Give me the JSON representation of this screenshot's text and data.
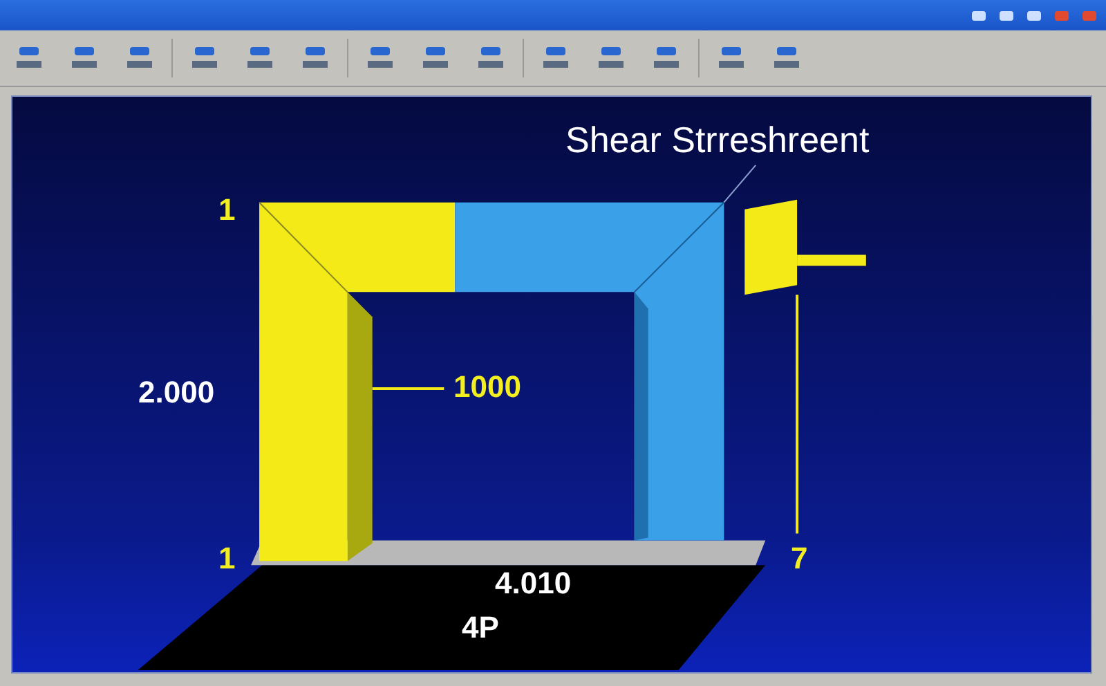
{
  "viewport": {
    "title": "Shear Strreshreent",
    "labels": [
      {
        "text": "1",
        "kind": "dimension"
      },
      {
        "text": "2.000",
        "kind": "value"
      },
      {
        "text": "1000",
        "kind": "dimension"
      },
      {
        "text": "1",
        "kind": "dimension"
      },
      {
        "text": "7",
        "kind": "dimension"
      },
      {
        "text": "4.010",
        "kind": "value"
      },
      {
        "text": "4P",
        "kind": "value"
      }
    ]
  }
}
